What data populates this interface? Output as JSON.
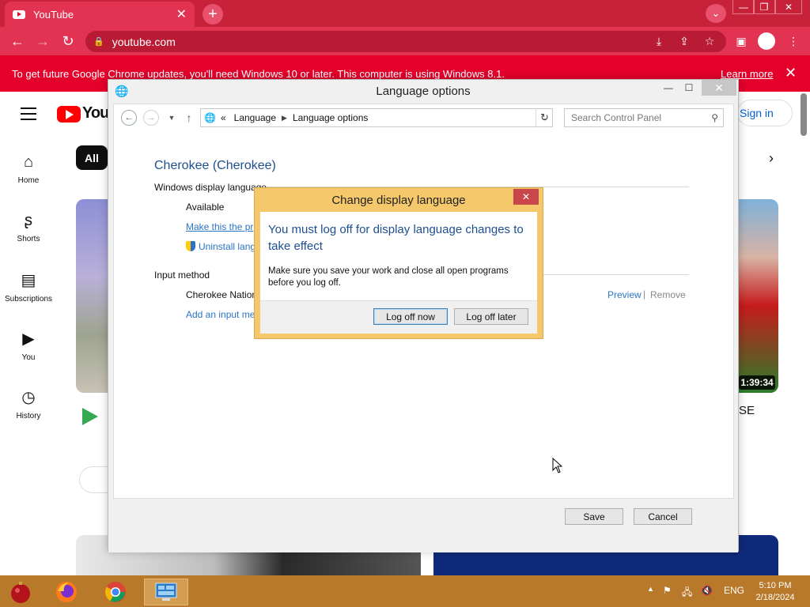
{
  "browser": {
    "tab_title": "YouTube",
    "tab_close": "✕",
    "new_tab": "+",
    "url": "youtube.com",
    "infobar_message": "To get future Google Chrome updates, you'll need Windows 10 or later. This computer is using Windows 8.1.",
    "infobar_link": "Learn more",
    "accent": "#e4002b"
  },
  "youtube": {
    "logo_text": "YouT",
    "chip_all": "All",
    "sign_in": "Sign in",
    "sidebar": [
      {
        "label": "Home",
        "icon": "home-icon"
      },
      {
        "label": "Shorts",
        "icon": "shorts-icon"
      },
      {
        "label": "Subscriptions",
        "icon": "subscriptions-icon"
      },
      {
        "label": "You",
        "icon": "you-icon"
      },
      {
        "label": "History",
        "icon": "history-icon"
      }
    ],
    "video_duration": "1:39:34",
    "title_fragment": "SE"
  },
  "control_panel": {
    "window_title": "Language options",
    "breadcrumb": [
      "Language",
      "Language options"
    ],
    "breadcrumb_prefix": "«",
    "search_placeholder": "Search Control Panel",
    "language_heading": "Cherokee (Cherokee)",
    "display_language_label": "Windows display language",
    "available_label": "Available",
    "make_primary_link": "Make this the pr",
    "uninstall_link": "Uninstall lang",
    "input_method_label": "Input method",
    "input_method_value": "Cherokee Nation",
    "add_input_method_link": "Add an input me",
    "preview_link": "Preview",
    "link_separator": "|",
    "remove_link": "Remove",
    "save_button": "Save",
    "cancel_button": "Cancel"
  },
  "dialog": {
    "title": "Change display language",
    "close": "✕",
    "heading": "You must log off for display language changes to take effect",
    "message": "Make sure you save your work and close all open programs before you log off.",
    "log_off_now": "Log off now",
    "log_off_later": "Log off later"
  },
  "taskbar": {
    "language": "ENG",
    "time": "5:10 PM",
    "date": "2/18/2024"
  }
}
